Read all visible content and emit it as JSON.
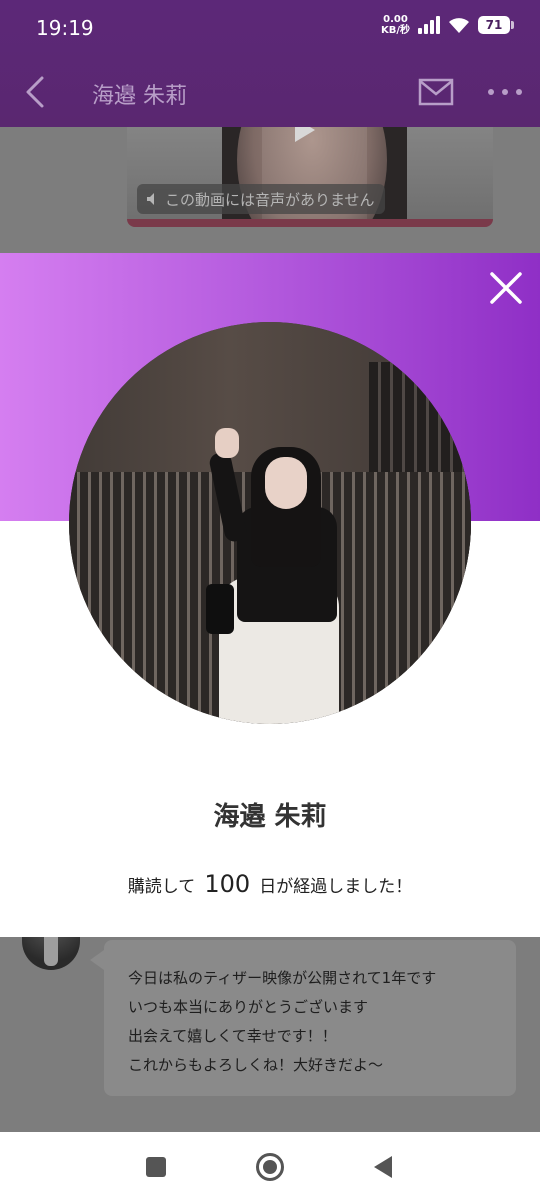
{
  "status_bar": {
    "time": "19:19",
    "net_speed_value": "0.00",
    "net_speed_unit": "KB/秒",
    "battery_level": "71"
  },
  "app_bar": {
    "title": "海邉 朱莉",
    "back_icon": "chevron-left-icon",
    "mail_icon": "mail-icon",
    "more_icon": "more-horizontal-icon"
  },
  "video_message": {
    "mute_label": "この動画には音声がありません",
    "play_icon": "play-icon",
    "mute_icon": "speaker-mute-icon"
  },
  "modal": {
    "profile_name": "海邉 朱莉",
    "subscribe_prefix": "購読して",
    "subscribe_days": "100",
    "subscribe_suffix": "日が経過しました！",
    "close_icon": "close-icon",
    "gradient_start": "#d57ef0",
    "gradient_end": "#8f2fc6"
  },
  "chat_message": {
    "lines": [
      "今日は私のティザー映像が公開されて1年です",
      "いつも本当にありがとうございます",
      "出会えて嬉しくて幸せです！！",
      "これからもよろしくね！大好きだよ〜"
    ]
  },
  "nav_bar": {
    "recents_icon": "square-icon",
    "home_icon": "circle-home-icon",
    "back_icon": "triangle-back-icon"
  },
  "colors": {
    "header_purple": "#5c2878",
    "dim_gray": "#7d7d7d"
  }
}
